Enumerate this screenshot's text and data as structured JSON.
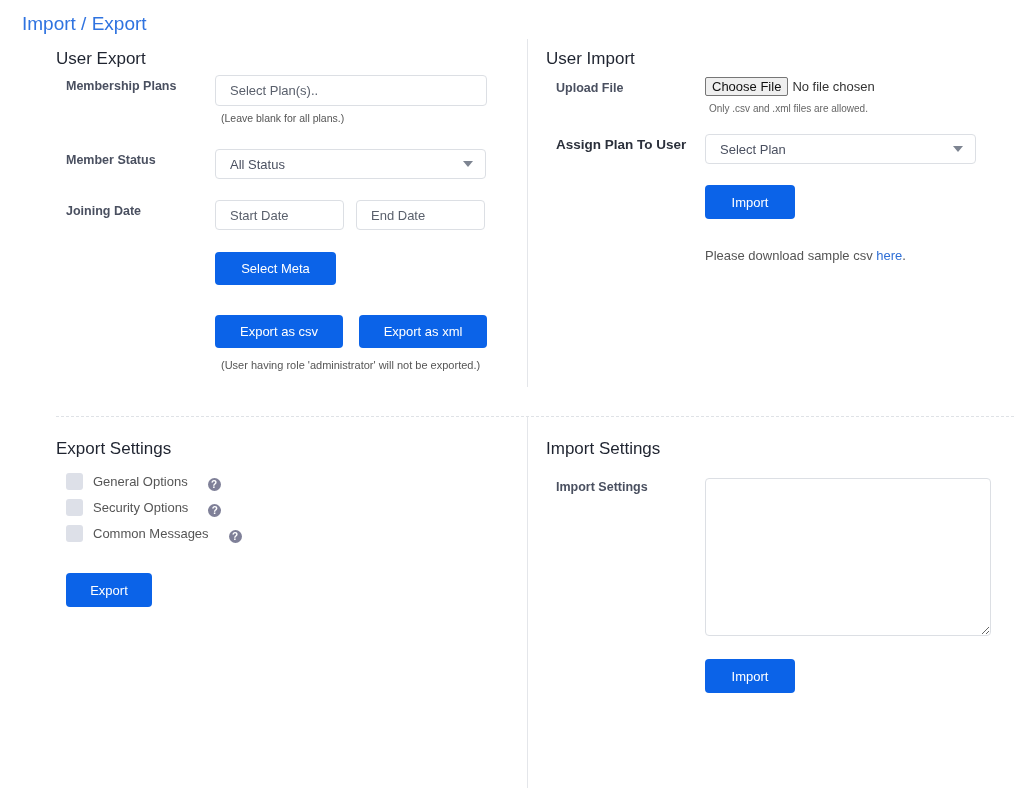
{
  "page_title": "Import / Export",
  "user_export": {
    "heading": "User Export",
    "membership_plans": {
      "label": "Membership Plans",
      "placeholder": "Select Plan(s)..",
      "hint": "(Leave blank for all plans.)"
    },
    "member_status": {
      "label": "Member Status",
      "value": "All Status"
    },
    "joining_date": {
      "label": "Joining Date",
      "start_placeholder": "Start Date",
      "end_placeholder": "End Date"
    },
    "select_meta_button": "Select Meta",
    "export_buttons": [
      "Export as csv",
      "Export as xml"
    ],
    "note": "(User having role 'administrator' will not be exported.)"
  },
  "user_import": {
    "heading": "User Import",
    "upload_file": {
      "label": "Upload File",
      "button": "Choose File",
      "status": "No file chosen",
      "hint": "Only .csv and .xml files are allowed."
    },
    "assign_plan": {
      "label": "Assign Plan To User",
      "value": "Select Plan"
    },
    "import_button": "Import",
    "sample_text": "Please download sample csv ",
    "sample_link": "here",
    "sample_end": "."
  },
  "export_settings": {
    "heading": "Export Settings",
    "options": [
      {
        "label": "General Options",
        "checked": false,
        "help": "?"
      },
      {
        "label": "Security Options",
        "checked": false,
        "help": "?"
      },
      {
        "label": "Common Messages",
        "checked": false,
        "help": "?"
      }
    ],
    "export_button": "Export"
  },
  "import_settings": {
    "heading": "Import Settings",
    "label": "Import Settings",
    "import_button": "Import"
  }
}
